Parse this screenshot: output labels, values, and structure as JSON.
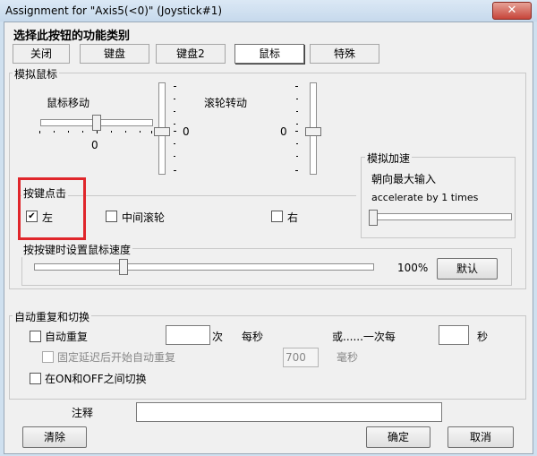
{
  "window": {
    "title": "Assignment for \"Axis5(<0)\" (Joystick#1)",
    "close_glyph": "✕"
  },
  "header": {
    "title": "选择此按钮的功能类别"
  },
  "tabs": [
    {
      "label": "关闭"
    },
    {
      "label": "键盘"
    },
    {
      "label": "键盘2"
    },
    {
      "label": "鼠标"
    },
    {
      "label": "特殊"
    }
  ],
  "mouse_group": {
    "label": "模拟鼠标",
    "move_label": "鼠标移动",
    "move_value": "0",
    "vert_value": "0",
    "wheel_label": "滚轮转动",
    "wheel_value": "0"
  },
  "key_click_group": {
    "label": "按键点击",
    "left": "左",
    "middle": "中间滚轮",
    "right": "右",
    "left_checked": "✔"
  },
  "accel_group": {
    "label": "模拟加速",
    "toward_max": "朝向最大输入",
    "accelerate_text": "accelerate by 1 times"
  },
  "speed_group": {
    "label": "按按键时设置鼠标速度",
    "percent": "100%",
    "default_button": "默认"
  },
  "repeat_group": {
    "label": "自动重复和切换",
    "auto_repeat": "自动重复",
    "times_label": "次",
    "per_second": "每秒",
    "or_each": "或......一次每",
    "seconds_label": "秒",
    "delay_label": "固定延迟后开始自动重复",
    "delay_value": "700",
    "ms_label": "毫秒",
    "toggle_label": "在ON和OFF之间切换"
  },
  "footer": {
    "note_label": "注释",
    "clear_button": "清除",
    "ok_button": "确定",
    "cancel_button": "取消"
  }
}
